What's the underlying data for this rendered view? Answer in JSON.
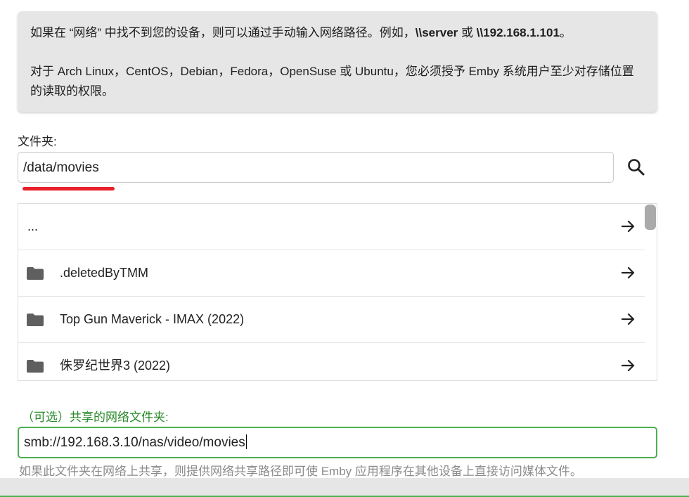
{
  "info": {
    "line1_pre": "如果在 “网络” 中找不到您的设备，则可以通过手动输入网络路径。例如，",
    "line1_server": "\\\\server",
    "line1_or": " 或 ",
    "line1_ip": "\\\\192.168.1.101",
    "line1_end": "。",
    "line2": "对于 Arch Linux，CentOS，Debian，Fedora，OpenSuse 或 Ubuntu，您必须授予 Emby 系统用户至少对存储位置的读取的权限。"
  },
  "folder": {
    "label": "文件夹:",
    "value": "/data/movies"
  },
  "file_list": [
    {
      "name": "...",
      "has_folder_icon": false
    },
    {
      "name": ".deletedByTMM",
      "has_folder_icon": true
    },
    {
      "name": "Top Gun Maverick - IMAX (2022)",
      "has_folder_icon": true
    },
    {
      "name": "侏罗纪世界3 (2022)",
      "has_folder_icon": true
    }
  ],
  "shared": {
    "label": "（可选）共享的网络文件夹:",
    "value": "smb://192.168.3.10/nas/video/movies",
    "helper": "如果此文件夹在网络上共享，则提供网络共享路径即可使 Emby 应用程序在其他设备上直接访问媒体文件。"
  },
  "icons": {
    "search": "search-icon",
    "folder": "folder-icon",
    "arrow": "arrow-right-icon"
  },
  "colors": {
    "accent_green": "#4caf50",
    "label_green": "#2a8a2a",
    "highlight_red": "#e8202a",
    "info_bg": "#e6e6e6"
  }
}
